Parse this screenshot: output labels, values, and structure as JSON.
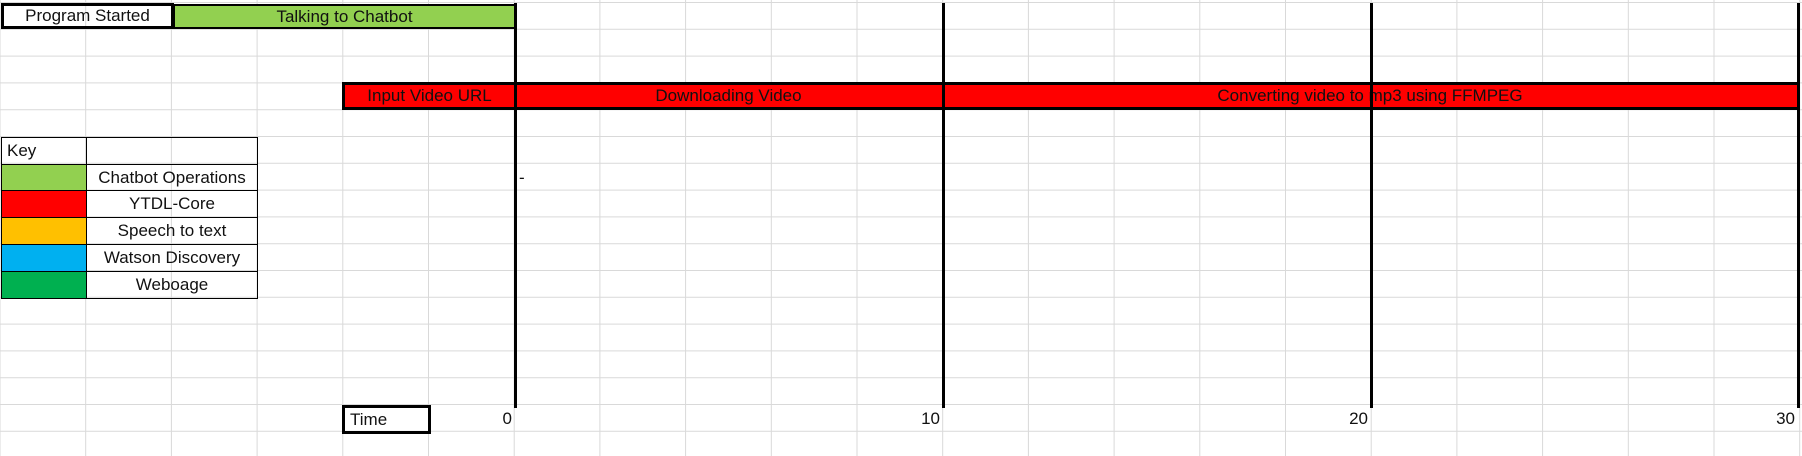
{
  "top_row": {
    "program_started": "Program Started",
    "talking_to_chatbot": "Talking to Chatbot"
  },
  "timeline": {
    "input_video_url": "Input Video URL",
    "downloading_video": "Downloading Video",
    "converting": "Converting video to mp3 using FFMPEG",
    "dash_marker": "-"
  },
  "key": {
    "title": "Key",
    "items": [
      {
        "label": "Chatbot Operations",
        "color": "#92d050"
      },
      {
        "label": "YTDL-Core",
        "color": "#ff0000"
      },
      {
        "label": "Speech to text",
        "color": "#ffc000"
      },
      {
        "label": "Watson Discovery",
        "color": "#00b0f0"
      },
      {
        "label": "Weboage",
        "color": "#00b050"
      }
    ]
  },
  "axis": {
    "time_label": "Time",
    "ticks": [
      "0",
      "10",
      "20",
      "30"
    ]
  }
}
